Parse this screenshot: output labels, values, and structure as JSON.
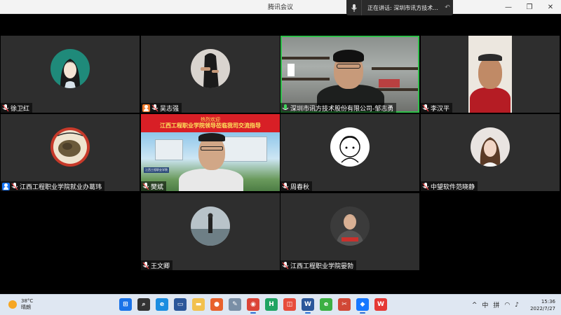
{
  "window": {
    "title": "腾讯会议",
    "controls": {
      "minimize": "—",
      "maximize": "❐",
      "close": "✕"
    }
  },
  "speaking_bar": {
    "label": "正在讲话: 深圳市讯方技术..."
  },
  "participants": [
    {
      "id": "p1",
      "name": "徐卫红",
      "type": "avatar",
      "muted": true,
      "badge": "none"
    },
    {
      "id": "p2",
      "name": "吴志强",
      "type": "avatar",
      "muted": true,
      "badge": "orange-user"
    },
    {
      "id": "p3",
      "name": "深圳市讯方技术股份有限公司-邹志勇",
      "type": "video",
      "speaking": true,
      "badge": "none"
    },
    {
      "id": "p4",
      "name": "李汉平",
      "type": "video",
      "muted": true,
      "badge": "none"
    },
    {
      "id": "p5",
      "name": "江西工程职业学院就业办葛玮",
      "type": "avatar",
      "muted": true,
      "badge": "blue-user"
    },
    {
      "id": "p6",
      "name": "樊斌",
      "type": "video",
      "muted": true,
      "badge": "none",
      "banner_line1": "热烈欢迎",
      "banner_line2": "江西工程职业学院领导莅临我司交流指导",
      "sign_text": "江西工程职业学院"
    },
    {
      "id": "p7",
      "name": "周春秋",
      "type": "avatar",
      "muted": true,
      "badge": "none"
    },
    {
      "id": "p8",
      "name": "中望软件范晓静",
      "type": "avatar",
      "muted": true,
      "badge": "none"
    },
    {
      "id": "p9",
      "name": "王文卿",
      "type": "avatar",
      "muted": true,
      "badge": "none"
    },
    {
      "id": "p10",
      "name": "江西工程职业学院晏勃",
      "type": "avatar",
      "muted": true,
      "badge": "none"
    }
  ],
  "taskbar": {
    "weather": {
      "temp": "38°C",
      "desc": "晴朗"
    },
    "apps": [
      {
        "name": "start",
        "glyph": "⊞",
        "color": "#1a73e8"
      },
      {
        "name": "search",
        "glyph": "⌕",
        "color": "#333333"
      },
      {
        "name": "edge",
        "glyph": "e",
        "color": "#1b8de0"
      },
      {
        "name": "desktop",
        "glyph": "▭",
        "color": "#2b579a"
      },
      {
        "name": "folder",
        "glyph": "▬",
        "color": "#f2c14e"
      },
      {
        "name": "firefox",
        "glyph": "●",
        "color": "#e8612c"
      },
      {
        "name": "chat",
        "glyph": "✎",
        "color": "#7a8fa6"
      },
      {
        "name": "chrome",
        "glyph": "◉",
        "color": "#db4437"
      },
      {
        "name": "h-app",
        "glyph": "H",
        "color": "#1fa463"
      },
      {
        "name": "calendar",
        "glyph": "◫",
        "color": "#e74c3c"
      },
      {
        "name": "word",
        "glyph": "W",
        "color": "#2b579a"
      },
      {
        "name": "browser360",
        "glyph": "e",
        "color": "#3cb043"
      },
      {
        "name": "screenshot",
        "glyph": "✂",
        "color": "#d14836"
      },
      {
        "name": "tencent-meeting",
        "glyph": "◆",
        "color": "#1677ff"
      },
      {
        "name": "wps",
        "glyph": "W",
        "color": "#e53935"
      }
    ],
    "tray": {
      "chevron": "^",
      "ime": "中",
      "pinyin": "拼"
    },
    "clock": {
      "time": "15:36",
      "date": "2022/7/27"
    }
  }
}
